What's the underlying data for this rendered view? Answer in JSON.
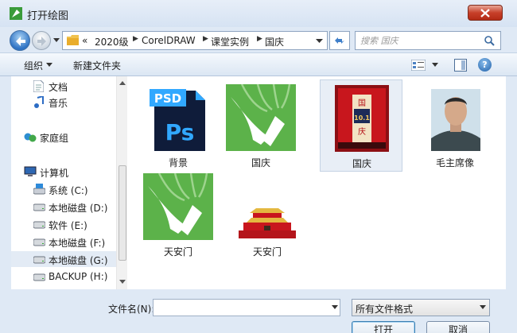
{
  "window": {
    "title": "打开绘图"
  },
  "address": {
    "overflow": "«",
    "crumbs": [
      "2020级",
      "CorelDRAW",
      "课堂实例",
      "国庆"
    ],
    "search_placeholder": "搜索 国庆"
  },
  "toolbar": {
    "organize": "组织",
    "new_folder": "新建文件夹"
  },
  "nav": {
    "items": [
      {
        "label": "文档",
        "icon": "document-icon"
      },
      {
        "label": "音乐",
        "icon": "music-icon"
      },
      {
        "label": "家庭组",
        "icon": "homegroup-icon"
      },
      {
        "label": "计算机",
        "icon": "computer-icon"
      },
      {
        "label": "系统 (C:)",
        "icon": "system-drive-icon"
      },
      {
        "label": "本地磁盘 (D:)",
        "icon": "drive-icon"
      },
      {
        "label": "软件 (E:)",
        "icon": "drive-icon"
      },
      {
        "label": "本地磁盘 (F:)",
        "icon": "drive-icon"
      },
      {
        "label": "本地磁盘 (G:)",
        "icon": "drive-icon"
      },
      {
        "label": "BACKUP (H:)",
        "icon": "drive-icon"
      }
    ]
  },
  "files": [
    {
      "name": "背景",
      "thumb": "photoshop-psd-icon",
      "badge": "PSD",
      "glyph": "Ps"
    },
    {
      "name": "国庆",
      "thumb": "coreldraw-file-icon"
    },
    {
      "name": "国庆",
      "thumb": "national-day-poster-thumbnail",
      "text": "国",
      "number": "10.1",
      "text2": "庆"
    },
    {
      "name": "毛主席像",
      "thumb": "portrait-thumbnail"
    },
    {
      "name": "天安门",
      "thumb": "coreldraw-file-icon"
    },
    {
      "name": "天安门",
      "thumb": "tiananmen-thumbnail"
    }
  ],
  "bottom": {
    "filename_label": "文件名(N):",
    "filename_value": "",
    "filetype_value": "所有文件格式",
    "open_button": "打开",
    "cancel_button": "取消"
  },
  "colors": {
    "corel_green": "#5cb24a",
    "psd_blue": "#0f1c3a",
    "psd_accent": "#31a8ff",
    "poster_red": "#c8161d"
  }
}
